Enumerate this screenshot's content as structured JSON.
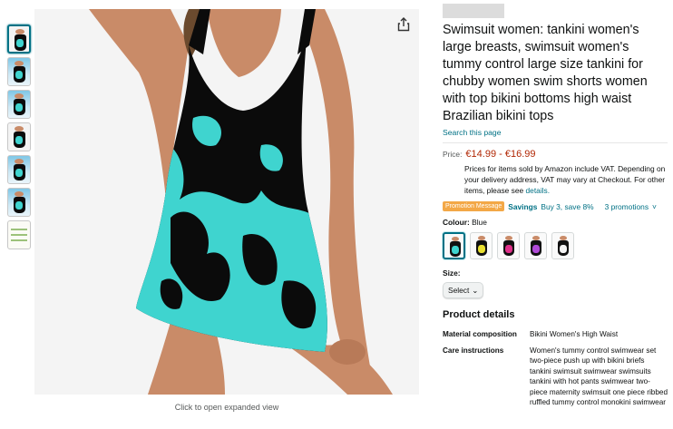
{
  "colors": {
    "accent_link": "#007185",
    "price_red": "#b12704",
    "promo_orange": "#f3a847",
    "swimsuit_black": "#0b0b0b",
    "swimsuit_teal": "#3fd4cf"
  },
  "gallery": {
    "thumbnails": [
      {
        "name": "thumb-1",
        "selected": true
      },
      {
        "name": "thumb-2"
      },
      {
        "name": "thumb-3"
      },
      {
        "name": "thumb-4"
      },
      {
        "name": "thumb-5"
      },
      {
        "name": "thumb-6"
      },
      {
        "name": "thumb-7"
      }
    ],
    "caption": "Click to open expanded view",
    "share_icon": "share-icon"
  },
  "product": {
    "title": "Swimsuit women: tankini women's large breasts, swimsuit women's tummy control large size tankini for chubby women swim shorts women with top bikini bottoms high waist Brazilian bikini tops",
    "store_link": "Search this page",
    "price_label": "Price:",
    "price": "€14.99 - €16.99",
    "vat_text": "Prices for items sold by Amazon include VAT. Depending on your delivery address, VAT may vary at Checkout. For other items, please see",
    "vat_link": "details.",
    "promo_badge": "Promotion Message",
    "savings_label": "Savings",
    "savings_text": "Buy 3, save 8%",
    "promotions_link": "3 promotions",
    "colour_label": "Colour:",
    "colour_value": "Blue",
    "swatch_colors": [
      "#3fd4cf",
      "#e9e030",
      "#e0308a",
      "#b04ad8",
      "#f4f4f4"
    ],
    "size_label": "Size:",
    "size_select": "Select",
    "details_heading": "Product details",
    "details": [
      {
        "key": "Material composition",
        "value": "Bikini Women's High Waist"
      },
      {
        "key": "Care instructions",
        "value": "Women's tummy control swimwear set two-piece push up with bikini briefs tankini swimsuit swimwear swimsuits tankini with hot pants swimwear two-piece maternity swimsuit one piece ribbed ruffled tummy control monokini swimwear"
      }
    ]
  }
}
